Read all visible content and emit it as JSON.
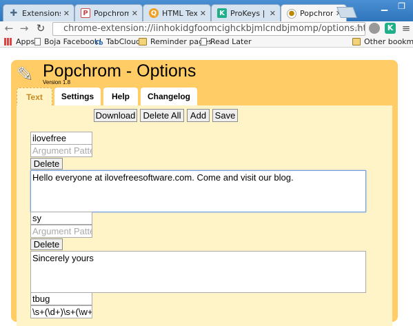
{
  "browser": {
    "tabs": [
      {
        "title": "Extensions",
        "icon": "puzzle-icon"
      },
      {
        "title": "Popchrom - Ch",
        "icon": "popchrom-favicon"
      },
      {
        "title": "HTML Text Bo",
        "icon": "html-favicon"
      },
      {
        "title": "ProKeys | Opt",
        "icon": "prokeys-favicon"
      },
      {
        "title": "Popchrom - Op",
        "icon": "popchrom-options-favicon"
      }
    ],
    "tab_close": "✕",
    "url": "chrome-extension://iinhokidgfoomcighckbjmlcndbjmomp/options.html",
    "extension_badge": "K"
  },
  "bookmarks": {
    "items": [
      "Apps",
      "Boja Facebook!",
      "TabCloud",
      "Reminder pages",
      "Read Later"
    ],
    "other": "Other bookmarks"
  },
  "app": {
    "title": "Popchrom - Options",
    "version": "Version 1.8",
    "tabs": [
      "Text",
      "Settings",
      "Help",
      "Changelog"
    ],
    "active_tab": "Text"
  },
  "toolbar": {
    "download": "Download",
    "delete_all": "Delete All",
    "add": "Add",
    "save": "Save"
  },
  "entries": [
    {
      "abbreviation": "ilovefree",
      "argument_placeholder": "Argument Pattern",
      "delete": "Delete",
      "text": "Hello everyone at ilovefreesoftware.com. Come and visit our blog."
    },
    {
      "abbreviation": "sy",
      "argument_placeholder": "Argument Pattern",
      "delete": "Delete",
      "text": "Sincerely yours"
    },
    {
      "abbreviation": "tbug",
      "argument_pattern": "\\s+(\\d+)\\s+(\\w+)"
    }
  ],
  "colors": {
    "panel": "#ffcc66",
    "content": "#fff3c8",
    "active_tab_text": "#c98b1f",
    "tabstrip": "#3a82c9"
  }
}
